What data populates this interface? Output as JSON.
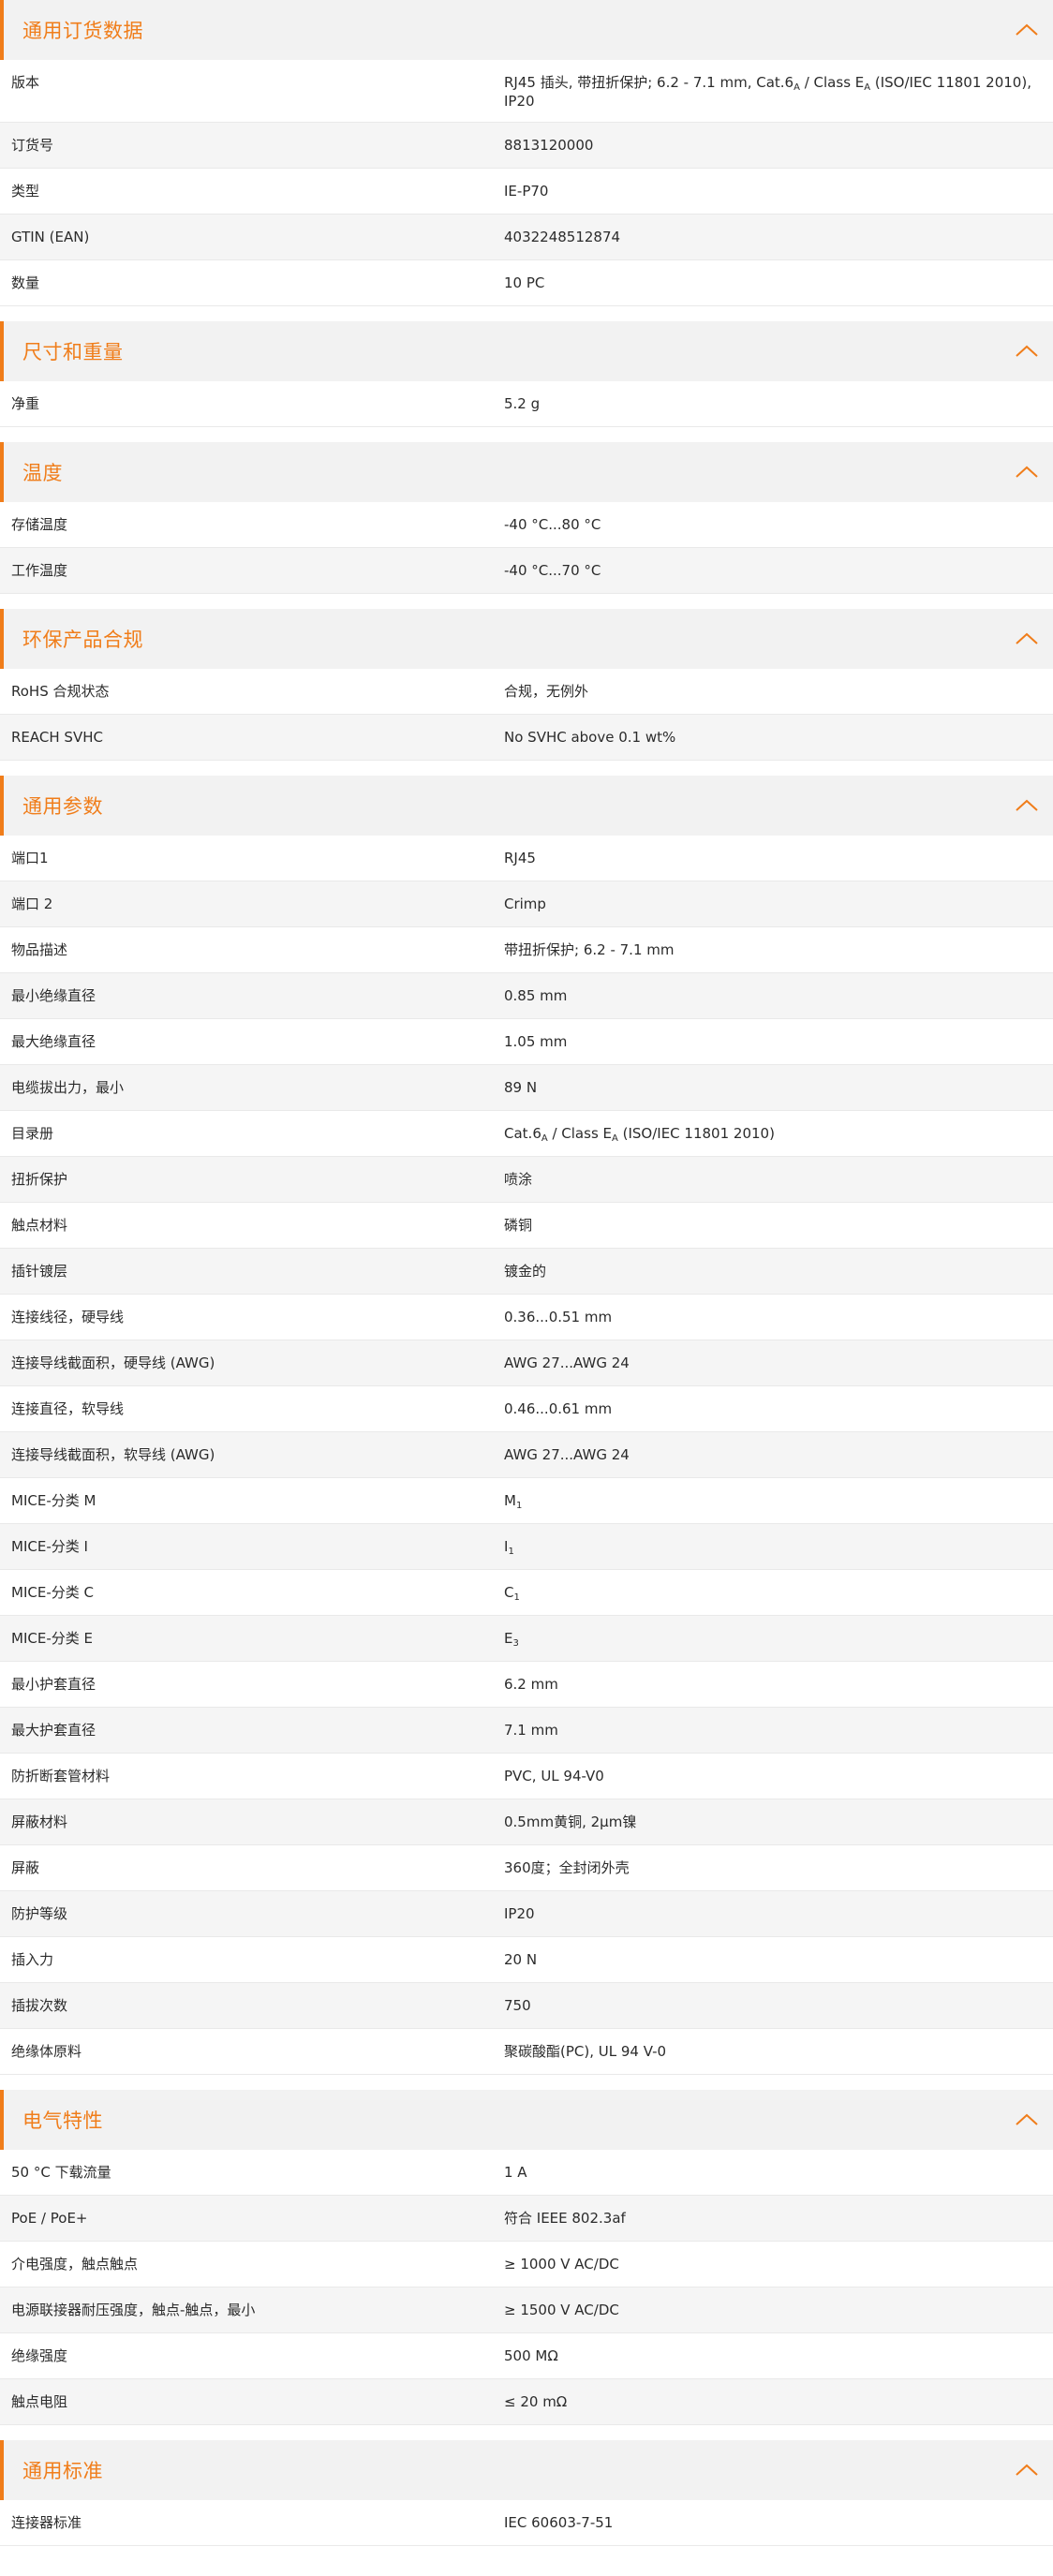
{
  "accent_color": "#f07d1a",
  "collapse_icon": "chevron-up-icon",
  "sections": [
    {
      "title": "通用订货数据",
      "rows": [
        {
          "label": "版本",
          "value": [
            {
              "t": "RJ45 插头, 带扭折保护; 6.2 - 7.1 mm, Cat.6"
            },
            {
              "t": "A",
              "sub": true
            },
            {
              "t": " / Class E"
            },
            {
              "t": "A",
              "sub": true
            },
            {
              "t": " (ISO/IEC 11801 2010), IP20"
            }
          ]
        },
        {
          "label": "订货号",
          "value": [
            {
              "t": "8813120000"
            }
          ]
        },
        {
          "label": "类型",
          "value": [
            {
              "t": "IE-P70"
            }
          ]
        },
        {
          "label": "GTIN (EAN)",
          "value": [
            {
              "t": "4032248512874"
            }
          ]
        },
        {
          "label": "数量",
          "value": [
            {
              "t": "10  PC"
            }
          ]
        }
      ]
    },
    {
      "title": "尺寸和重量",
      "rows": [
        {
          "label": "净重",
          "value": [
            {
              "t": "5.2  g"
            }
          ]
        }
      ]
    },
    {
      "title": "温度",
      "rows": [
        {
          "label": "存储温度",
          "value": [
            {
              "t": "-40 °C...80 °C"
            }
          ]
        },
        {
          "label": "工作温度",
          "value": [
            {
              "t": "-40 °C...70 °C"
            }
          ]
        }
      ]
    },
    {
      "title": "环保产品合规",
      "rows": [
        {
          "label": "RoHS 合规状态",
          "value": [
            {
              "t": "合规，无例外"
            }
          ]
        },
        {
          "label": "REACH SVHC",
          "value": [
            {
              "t": "No SVHC above 0.1 wt%"
            }
          ]
        }
      ]
    },
    {
      "title": "通用参数",
      "rows": [
        {
          "label": "端口1",
          "value": [
            {
              "t": "RJ45"
            }
          ]
        },
        {
          "label": "端口 2",
          "value": [
            {
              "t": "Crimp"
            }
          ]
        },
        {
          "label": "物品描述",
          "value": [
            {
              "t": "带扭折保护; 6.2 - 7.1 mm"
            }
          ]
        },
        {
          "label": "最小绝缘直径",
          "value": [
            {
              "t": "0.85  mm"
            }
          ]
        },
        {
          "label": "最大绝缘直径",
          "value": [
            {
              "t": "1.05  mm"
            }
          ]
        },
        {
          "label": "电缆拔出力，最小",
          "value": [
            {
              "t": "89  N"
            }
          ]
        },
        {
          "label": "目录册",
          "value": [
            {
              "t": "Cat.6"
            },
            {
              "t": "A",
              "sub": true
            },
            {
              "t": " / Class E"
            },
            {
              "t": "A",
              "sub": true
            },
            {
              "t": " (ISO/IEC 11801 2010)"
            }
          ]
        },
        {
          "label": "扭折保护",
          "value": [
            {
              "t": "喷涂"
            }
          ]
        },
        {
          "label": "触点材料",
          "value": [
            {
              "t": "磷铜"
            }
          ]
        },
        {
          "label": "插针镀层",
          "value": [
            {
              "t": "镀金的"
            }
          ]
        },
        {
          "label": "连接线径，硬导线",
          "value": [
            {
              "t": "0.36...0.51 mm"
            }
          ]
        },
        {
          "label": "连接导线截面积，硬导线 (AWG)",
          "value": [
            {
              "t": "AWG 27...AWG 24"
            }
          ]
        },
        {
          "label": "连接直径，软导线",
          "value": [
            {
              "t": "0.46...0.61 mm"
            }
          ]
        },
        {
          "label": "连接导线截面积，软导线 (AWG)",
          "value": [
            {
              "t": "AWG 27...AWG 24"
            }
          ]
        },
        {
          "label": "MICE-分类 M",
          "value": [
            {
              "t": "M"
            },
            {
              "t": "1",
              "sub": true
            }
          ]
        },
        {
          "label": "MICE-分类 I",
          "value": [
            {
              "t": "I"
            },
            {
              "t": "1",
              "sub": true
            }
          ]
        },
        {
          "label": "MICE-分类 C",
          "value": [
            {
              "t": "C"
            },
            {
              "t": "1",
              "sub": true
            }
          ]
        },
        {
          "label": "MICE-分类 E",
          "value": [
            {
              "t": "E"
            },
            {
              "t": "3",
              "sub": true
            }
          ]
        },
        {
          "label": "最小护套直径",
          "value": [
            {
              "t": "6.2  mm"
            }
          ]
        },
        {
          "label": "最大护套直径",
          "value": [
            {
              "t": "7.1  mm"
            }
          ]
        },
        {
          "label": "防折断套管材料",
          "value": [
            {
              "t": "PVC, UL 94-V0"
            }
          ]
        },
        {
          "label": "屏蔽材料",
          "value": [
            {
              "t": "0.5mm黄铜, 2µm镍"
            }
          ]
        },
        {
          "label": "屏蔽",
          "value": [
            {
              "t": "360度；全封闭外壳"
            }
          ]
        },
        {
          "label": "防护等级",
          "value": [
            {
              "t": "IP20"
            }
          ]
        },
        {
          "label": "插入力",
          "value": [
            {
              "t": "20 N"
            }
          ]
        },
        {
          "label": "插拔次数",
          "value": [
            {
              "t": "750"
            }
          ]
        },
        {
          "label": "绝缘体原料",
          "value": [
            {
              "t": "聚碳酸酯(PC), UL 94 V-0"
            }
          ]
        }
      ]
    },
    {
      "title": "电气特性",
      "rows": [
        {
          "label": "50 °C 下载流量",
          "value": [
            {
              "t": "1  A"
            }
          ]
        },
        {
          "label": "PoE / PoE+",
          "value": [
            {
              "t": "符合 IEEE 802.3af"
            }
          ]
        },
        {
          "label": "介电强度，触点触点",
          "value": [
            {
              "t": "≥ 1000 V AC/DC"
            }
          ]
        },
        {
          "label": "电源联接器耐压强度，触点-触点，最小",
          "value": [
            {
              "t": "≥ 1500 V AC/DC"
            }
          ]
        },
        {
          "label": "绝缘强度",
          "value": [
            {
              "t": "500 MΩ"
            }
          ]
        },
        {
          "label": "触点电阻",
          "value": [
            {
              "t": "≤ 20 mΩ"
            }
          ]
        }
      ]
    },
    {
      "title": "通用标准",
      "rows": [
        {
          "label": "连接器标准",
          "value": [
            {
              "t": "IEC 60603-7-51"
            }
          ]
        }
      ]
    }
  ]
}
